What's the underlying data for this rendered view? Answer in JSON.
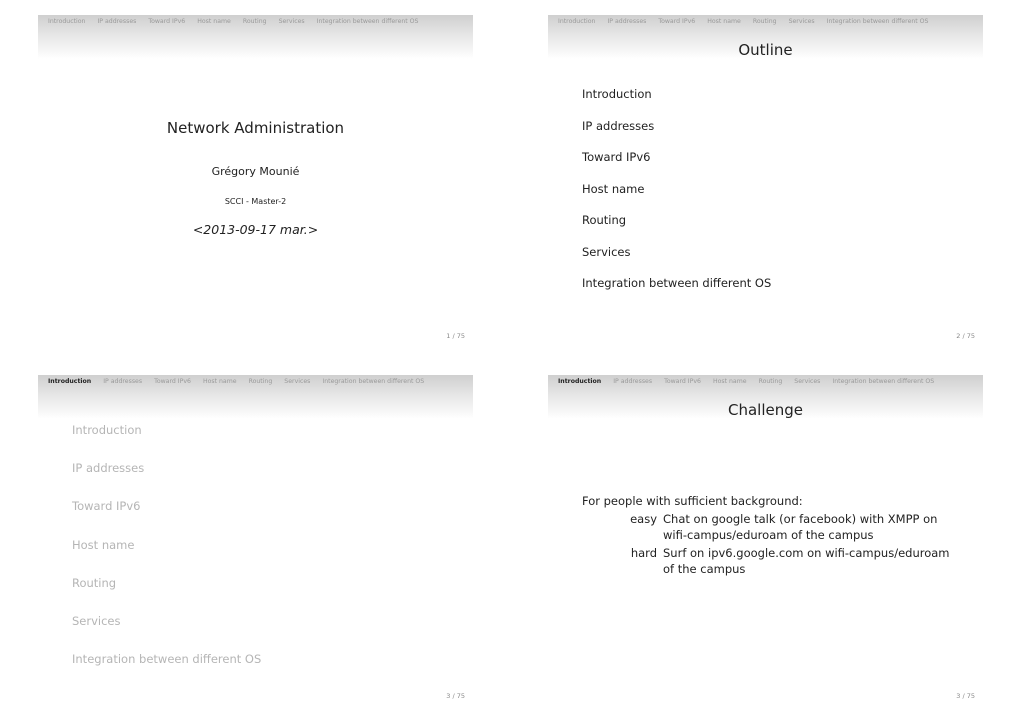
{
  "nav": [
    "Introduction",
    "IP addresses",
    "Toward IPv6",
    "Host name",
    "Routing",
    "Services",
    "Integration between different OS"
  ],
  "slides": {
    "s1": {
      "title": "Network Administration",
      "author": "Grégory Mounié",
      "institute": "SCCI - Master-2",
      "date": "<2013-09-17 mar.>",
      "page": "1 / 75"
    },
    "s2": {
      "title": "Outline",
      "items": [
        "Introduction",
        "IP addresses",
        "Toward IPv6",
        "Host name",
        "Routing",
        "Services",
        "Integration between different OS"
      ],
      "page": "2 / 75"
    },
    "s3": {
      "active_section": "Introduction",
      "items": [
        "Introduction",
        "IP addresses",
        "Toward IPv6",
        "Host name",
        "Routing",
        "Services",
        "Integration between different OS"
      ],
      "page": "3 / 75"
    },
    "s4": {
      "active_section": "Introduction",
      "title": "Challenge",
      "intro": "For people with sufficient background:",
      "entries": [
        {
          "term": "easy",
          "text": "Chat on google talk (or facebook) with XMPP on wifi-campus/eduroam of the campus"
        },
        {
          "term": "hard",
          "text": "Surf on ipv6.google.com on wifi-campus/eduroam of the campus"
        }
      ],
      "page": "3 / 75"
    }
  }
}
